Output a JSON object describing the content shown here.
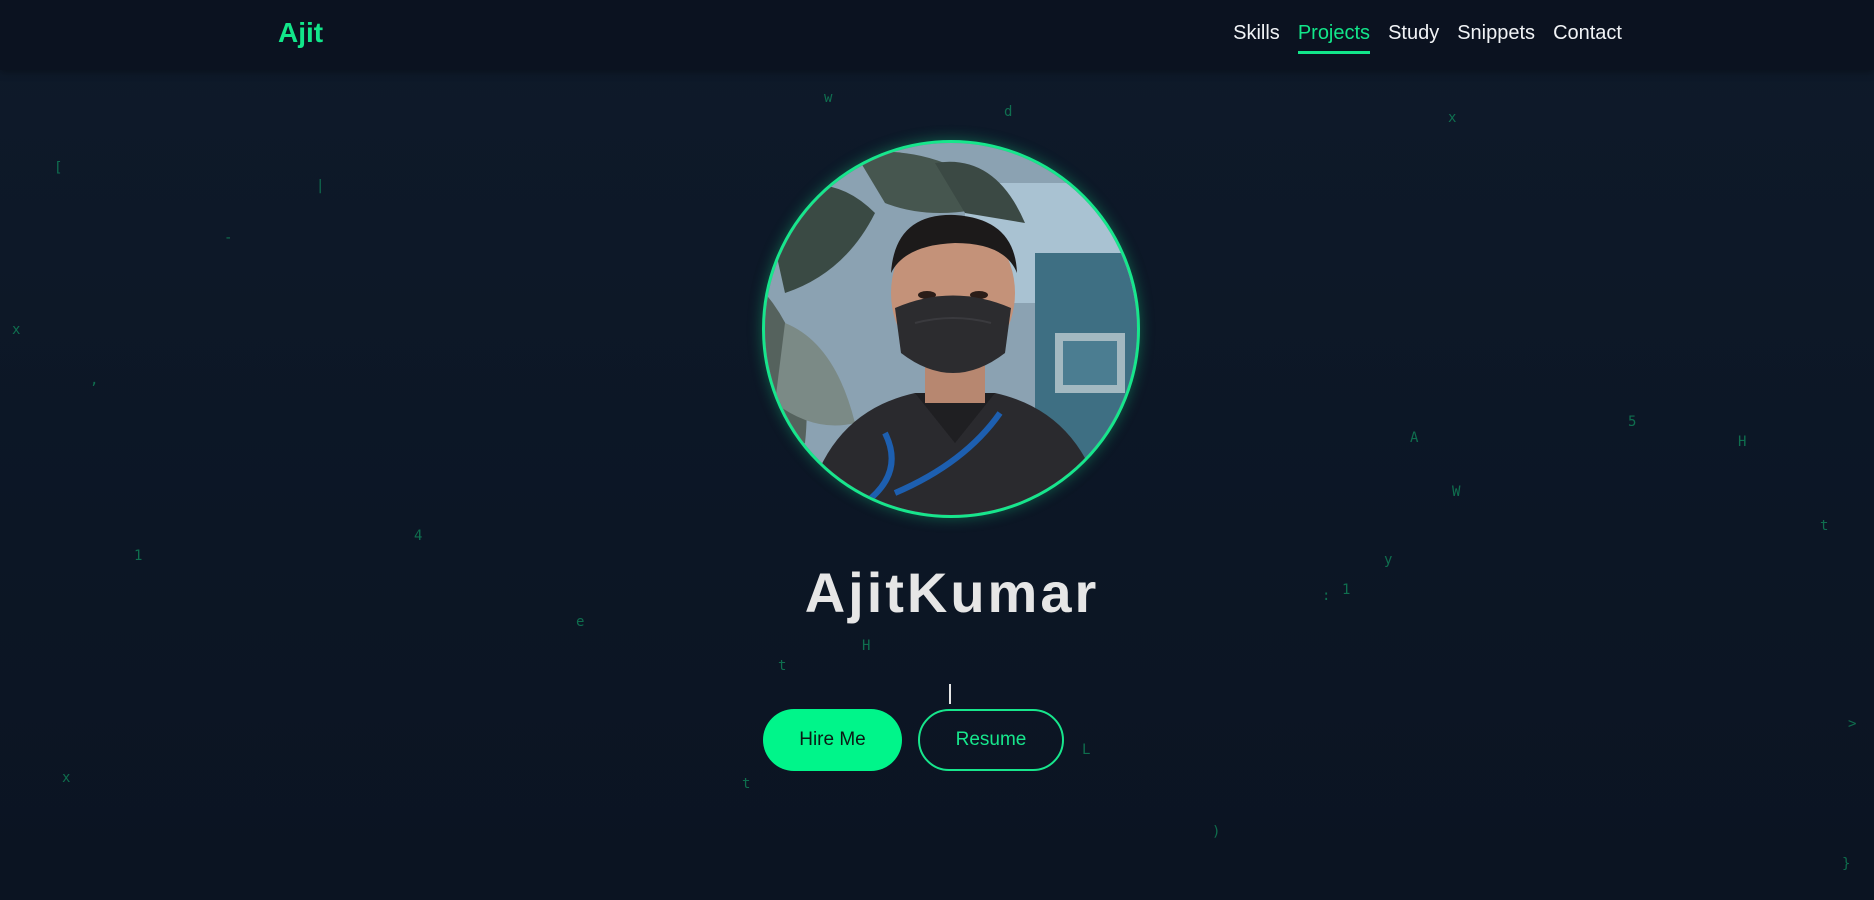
{
  "brand": {
    "name": "Ajit"
  },
  "nav": {
    "items": [
      {
        "label": "Skills",
        "active": false
      },
      {
        "label": "Projects",
        "active": true
      },
      {
        "label": "Study",
        "active": false
      },
      {
        "label": "Snippets",
        "active": false
      },
      {
        "label": "Contact",
        "active": false
      }
    ]
  },
  "hero": {
    "name": "AjitKumar",
    "hire_label": "Hire Me",
    "resume_label": "Resume"
  },
  "background_glyphs": [
    "w",
    "d",
    "x",
    "[",
    "|",
    "-",
    "x",
    ",",
    "A",
    "5",
    "H",
    "W",
    "t",
    "4",
    "1",
    "y",
    ":",
    "1",
    "e",
    "H",
    "t",
    "L",
    ">",
    "x",
    "t",
    ")",
    "}"
  ],
  "colors": {
    "accent": "#12e68a",
    "background": "#0d1726",
    "header": "#0b1220",
    "text": "#e6e6e6"
  }
}
